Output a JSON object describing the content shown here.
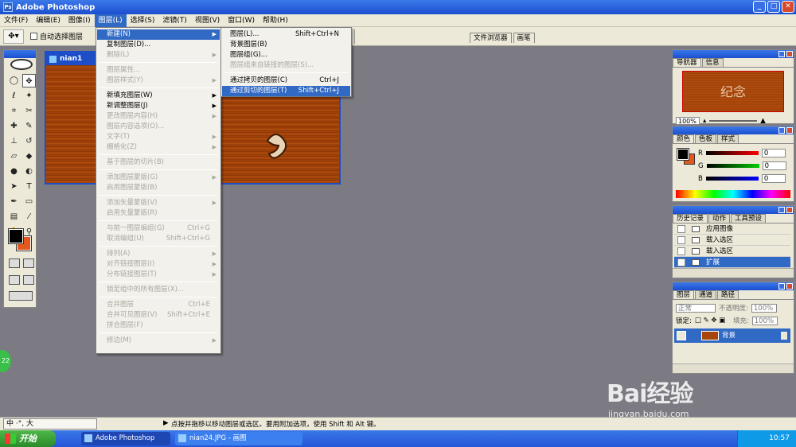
{
  "window": {
    "title": "Adobe Photoshop"
  },
  "menubar": [
    "文件(F)",
    "编辑(E)",
    "图像(I)",
    "图层(L)",
    "选择(S)",
    "滤镜(T)",
    "视图(V)",
    "窗口(W)",
    "帮助(H)"
  ],
  "options": {
    "auto_select_label": "自动选择图层",
    "tab_file_browser": "文件浏览器",
    "tab_brushes": "画笔"
  },
  "document": {
    "title": "nian1"
  },
  "layer_menu": [
    {
      "label": "新建(N)",
      "arrow": true,
      "state": "hl"
    },
    {
      "label": "复制图层(D)...",
      "state": "normal"
    },
    {
      "label": "删除(L)",
      "arrow": true,
      "state": "dis"
    },
    {
      "sep": true
    },
    {
      "label": "图层属性...",
      "state": "dis"
    },
    {
      "label": "图层样式(Y)",
      "arrow": true,
      "state": "dis"
    },
    {
      "sep": true
    },
    {
      "label": "新填充图层(W)",
      "arrow": true,
      "state": "normal"
    },
    {
      "label": "新调整图层(J)",
      "arrow": true,
      "state": "normal"
    },
    {
      "label": "更改图层内容(H)",
      "arrow": true,
      "state": "dis"
    },
    {
      "label": "图层内容选项(O)...",
      "state": "dis"
    },
    {
      "label": "文字(T)",
      "arrow": true,
      "state": "dis"
    },
    {
      "label": "栅格化(Z)",
      "arrow": true,
      "state": "dis"
    },
    {
      "sep": true
    },
    {
      "label": "基于图层的切片(B)",
      "state": "dis"
    },
    {
      "sep": true
    },
    {
      "label": "添加图层蒙版(G)",
      "arrow": true,
      "state": "dis"
    },
    {
      "label": "启用图层蒙版(B)",
      "state": "dis"
    },
    {
      "sep": true
    },
    {
      "label": "添加矢量蒙版(V)",
      "arrow": true,
      "state": "dis"
    },
    {
      "label": "启用矢量蒙版(R)",
      "state": "dis"
    },
    {
      "sep": true
    },
    {
      "label": "与前一图层编组(G)",
      "shortcut": "Ctrl+G",
      "state": "dis"
    },
    {
      "label": "取消编组(U)",
      "shortcut": "Shift+Ctrl+G",
      "state": "dis"
    },
    {
      "sep": true
    },
    {
      "label": "排列(A)",
      "arrow": true,
      "state": "dis"
    },
    {
      "label": "对齐链接图层(I)",
      "arrow": true,
      "state": "dis"
    },
    {
      "label": "分布链接图层(T)",
      "arrow": true,
      "state": "dis"
    },
    {
      "sep": true
    },
    {
      "label": "锁定组中的所有图层(X)...",
      "state": "dis"
    },
    {
      "sep": true
    },
    {
      "label": "合并图层",
      "shortcut": "Ctrl+E",
      "state": "dis"
    },
    {
      "label": "合并可见图层(V)",
      "shortcut": "Shift+Ctrl+E",
      "state": "dis"
    },
    {
      "label": "拼合图层(F)",
      "state": "dis"
    },
    {
      "sep": true
    },
    {
      "label": "修边(M)",
      "arrow": true,
      "state": "dis"
    }
  ],
  "new_submenu": [
    {
      "label": "图层(L)...",
      "shortcut": "Shift+Ctrl+N",
      "state": "normal"
    },
    {
      "label": "背景图层(B)",
      "state": "normal"
    },
    {
      "label": "图层组(G)...",
      "state": "normal"
    },
    {
      "label": "图层组来自链接的图层(S)...",
      "state": "dis"
    },
    {
      "sep": true
    },
    {
      "label": "通过拷贝的图层(C)",
      "shortcut": "Ctrl+J",
      "state": "normal"
    },
    {
      "label": "通过剪切的图层(T)",
      "shortcut": "Shift+Ctrl+J",
      "state": "hl"
    }
  ],
  "navigator": {
    "tabs": [
      "导航器",
      "信息"
    ],
    "preview_text": "纪念",
    "zoom": "100%"
  },
  "color": {
    "tabs": [
      "颜色",
      "色板",
      "样式"
    ],
    "channels": [
      {
        "name": "R",
        "value": "0",
        "bar": "#c00"
      },
      {
        "name": "G",
        "value": "0",
        "bar": "#0a0"
      },
      {
        "name": "B",
        "value": "0",
        "bar": "#00c"
      }
    ]
  },
  "history": {
    "tabs": [
      "历史记录",
      "动作",
      "工具预设"
    ],
    "items": [
      "应用图像",
      "载入选区",
      "载入选区",
      "扩展"
    ]
  },
  "layers": {
    "tabs": [
      "图层",
      "通道",
      "路径"
    ],
    "blend_mode": "正常",
    "opacity_label": "不透明度:",
    "opacity_value": "100%",
    "lock_label": "锁定:",
    "fill_label": "填充:",
    "fill_value": "100%",
    "layer_name": "背景"
  },
  "status": {
    "ime": "中 ·°, 大",
    "hint": "点按并拖移以移动图层或选区。要用附加选项，使用 Shift 和 Alt 键。"
  },
  "taskbar": {
    "start": "开始",
    "tasks": [
      "Adobe Photoshop",
      "nian24.JPG - 画图"
    ],
    "clock": "10:57"
  },
  "watermark": {
    "logo": "Bai经验",
    "url": "jingyan.baidu.com"
  },
  "badge": "22"
}
